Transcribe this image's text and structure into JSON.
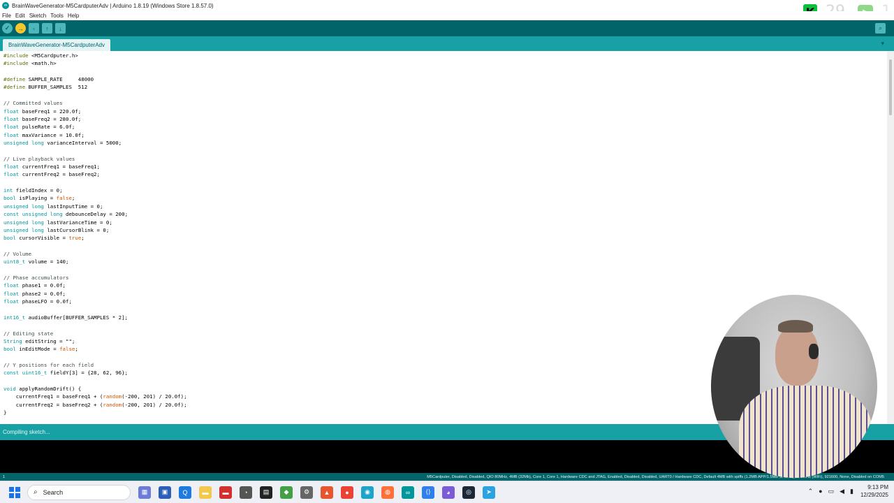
{
  "window": {
    "title": "BrainWaveGenerator-M5CardputerAdv | Arduino 1.8.19 (Windows Store 1.8.57.0)"
  },
  "overlay": {
    "k_badge": "K",
    "k_count": "29",
    "play_count": "1"
  },
  "menu": [
    "File",
    "Edit",
    "Sketch",
    "Tools",
    "Help"
  ],
  "toolbar": {
    "verify_icon": "check-icon",
    "upload_icon": "arrow-right-icon",
    "new_icon": "file-new-icon",
    "open_icon": "folder-open-icon",
    "save_icon": "save-icon",
    "serial_icon": "magnifier-icon"
  },
  "tab": {
    "label": "BrainWaveGenerator-M5CardputerAdv"
  },
  "code_lines": [
    "#include <M5Cardputer.h>",
    "#include <math.h>",
    "",
    "#define SAMPLE_RATE     48000",
    "#define BUFFER_SAMPLES  512",
    "",
    "// Committed values",
    "float baseFreq1 = 220.0f;",
    "float baseFreq2 = 280.0f;",
    "float pulseRate = 6.0f;",
    "float maxVariance = 10.0f;",
    "unsigned long varianceInterval = 5000;",
    "",
    "// Live playback values",
    "float currentFreq1 = baseFreq1;",
    "float currentFreq2 = baseFreq2;",
    "",
    "int fieldIndex = 0;",
    "bool isPlaying = false;",
    "unsigned long lastInputTime = 0;",
    "const unsigned long debounceDelay = 200;",
    "unsigned long lastVarianceTime = 0;",
    "unsigned long lastCursorBlink = 0;",
    "bool cursorVisible = true;",
    "",
    "// Volume",
    "uint8_t volume = 140;",
    "",
    "// Phase accumulators",
    "float phase1 = 0.0f;",
    "float phase2 = 0.0f;",
    "float phaseLFO = 0.0f;",
    "",
    "int16_t audioBuffer[BUFFER_SAMPLES * 2];",
    "",
    "// Editing state",
    "String editString = \"\";",
    "bool inEditMode = false;",
    "",
    "// Y positions for each field",
    "const uint16_t fieldY[3] = {28, 62, 96};",
    "",
    "void applyRandomDrift() {",
    "    currentFreq1 = baseFreq1 + (random(-200, 201) / 20.0f);",
    "    currentFreq2 = baseFreq2 + (random(-200, 201) / 20.0f);",
    "}"
  ],
  "status": {
    "message": "Compiling sketch..."
  },
  "footer": {
    "line_number": "1",
    "board_info": "M5Cardputer, Disabled, Disabled, QIO 80MHz, 4MB (32Mb), Core 1, Core 1, Hardware CDC and JTAG, Enabled, Disabled, Disabled, UART0 / Hardware CDC, Default 4MB with spiffs (1.2MB APP/1.5MB SPIFFS), 240MHz (WiFi), 921600, None, Disabled on COM5"
  },
  "taskbar": {
    "search_placeholder": "Search",
    "time": "9:13 PM",
    "date": "12/29/2025"
  },
  "colors": {
    "toolbar": "#006468",
    "tabstrip": "#17a1a5",
    "keyword": "#d35400",
    "type": "#00979c",
    "preprocessor": "#5e6d03",
    "comment": "#434f54"
  }
}
